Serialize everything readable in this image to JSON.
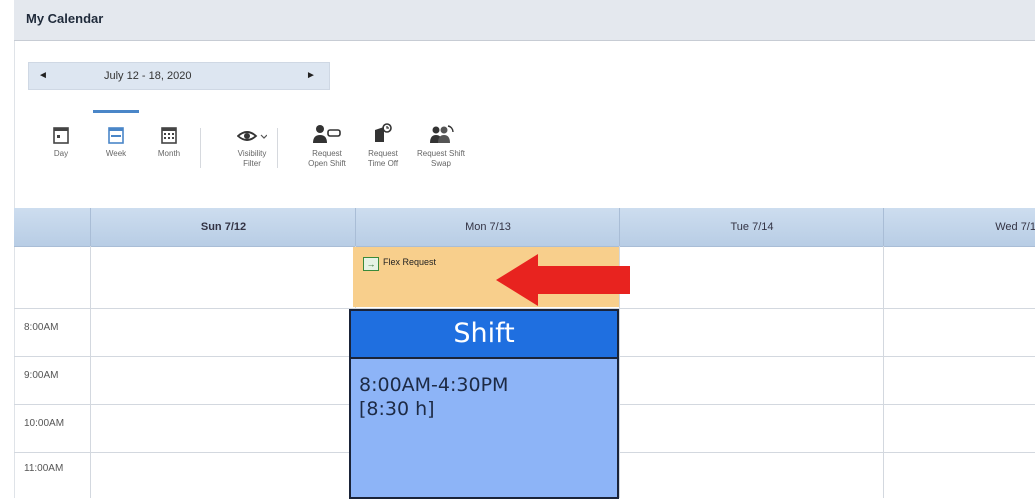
{
  "window": {
    "title": "My Calendar"
  },
  "date_nav": {
    "prev_glyph": "◄",
    "next_glyph": "►",
    "range": "July 12 - 18, 2020"
  },
  "toolbar": {
    "items": [
      {
        "label": "Day",
        "icon": "calendar-day-icon"
      },
      {
        "label": "Week",
        "icon": "calendar-week-icon",
        "active": true
      },
      {
        "label": "Month",
        "icon": "calendar-month-icon"
      },
      {
        "label": "Visibility\nFilter",
        "icon": "eye-icon"
      },
      {
        "label": "Request\nOpen Shift",
        "icon": "person-request-icon"
      },
      {
        "label": "Request\nTime Off",
        "icon": "time-off-icon"
      },
      {
        "label": "Request Shift\nSwap",
        "icon": "shift-swap-icon"
      }
    ]
  },
  "calendar": {
    "days": [
      "Sun 7/12",
      "Mon 7/13",
      "Tue 7/14",
      "Wed 7/1"
    ],
    "times": [
      "8:00AM",
      "9:00AM",
      "10:00AM",
      "11:00AM"
    ],
    "flex_request": {
      "label": "Flex Request",
      "color": "#f8cf8c"
    },
    "shift": {
      "title": "Shift",
      "time_range": "8:00AM-4:30PM",
      "duration": "[8:30 h]",
      "header_color": "#1f6fe0",
      "body_color": "#8db4f7"
    }
  },
  "annotation": {
    "arrow_color": "#e8231f"
  }
}
